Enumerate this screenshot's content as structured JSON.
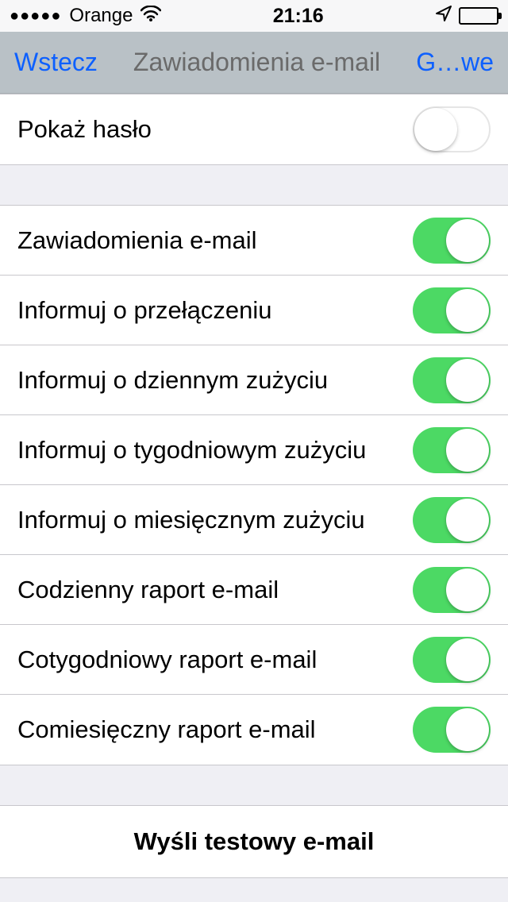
{
  "status": {
    "signal_dots": "●●●●●",
    "carrier": "Orange",
    "time": "21:16"
  },
  "nav": {
    "back": "Wstecz",
    "title": "Zawiadomienia e-mail",
    "right": "G…we"
  },
  "group1": {
    "show_password_label": "Pokaż hasło",
    "show_password_on": false
  },
  "group2": {
    "items": [
      {
        "label": "Zawiadomienia e-mail",
        "on": true
      },
      {
        "label": "Informuj o przełączeniu",
        "on": true
      },
      {
        "label": "Informuj o dziennym zużyciu",
        "on": true
      },
      {
        "label": "Informuj o tygodniowym zużyciu",
        "on": true
      },
      {
        "label": "Informuj o miesięcznym zużyciu",
        "on": true
      },
      {
        "label": "Codzienny raport e-mail",
        "on": true
      },
      {
        "label": "Cotygodniowy raport e-mail",
        "on": true
      },
      {
        "label": "Comiesięczny raport e-mail",
        "on": true
      }
    ]
  },
  "group3": {
    "send_test_label": "Wyśli testowy e-mail"
  }
}
